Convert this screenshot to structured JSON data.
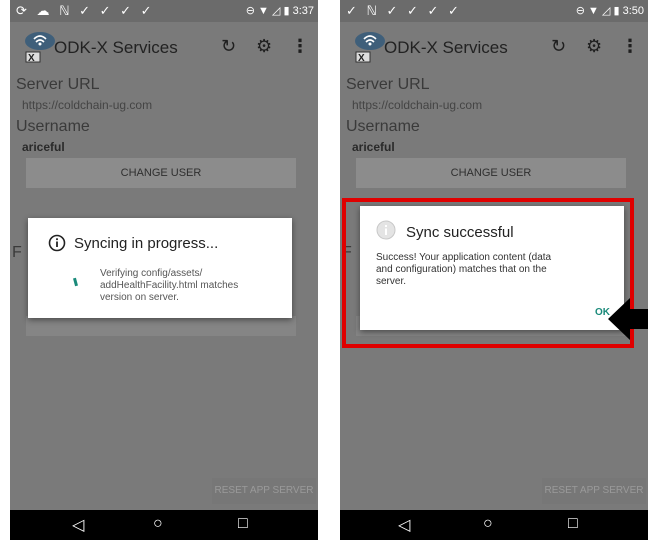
{
  "left_screen": {
    "status_time": "3:37",
    "app_title": "ODK-X Services",
    "server_url_label": "Server URL",
    "server_url_value": "https://coldchain-ug.com",
    "username_label": "Username",
    "username_value": "ariceful",
    "change_user_label": "CHANGE USER",
    "hidden_label_letter": "F",
    "reset_label": "RESET APP SERVER",
    "dialog": {
      "title": "Syncing in progress...",
      "message_line1": "Verifying config/assets/",
      "message_line2": "addHealthFacility.html matches",
      "message_line3": "version on server."
    }
  },
  "right_screen": {
    "status_time": "3:50",
    "app_title": "ODK-X Services",
    "server_url_label": "Server URL",
    "server_url_value": "https://coldchain-ug.com",
    "username_label": "Username",
    "username_value": "ariceful",
    "change_user_label": "CHANGE USER",
    "hidden_label_letter": "F",
    "reset_label": "RESET APP SERVER",
    "dialog": {
      "title": "Sync successful",
      "message_line1": "Success! Your application content (data",
      "message_line2": "and configuration) matches that on the",
      "message_line3": "server.",
      "ok_label": "OK"
    }
  },
  "colors": {
    "highlight_box": "#e00000",
    "ok_text": "#1a8a7a",
    "spinner": "#1a8a7a"
  },
  "icons": [
    "sync-icon",
    "settings-gear-icon",
    "overflow-menu-icon",
    "back-nav-icon",
    "home-nav-icon",
    "recents-nav-icon",
    "info-icon"
  ]
}
